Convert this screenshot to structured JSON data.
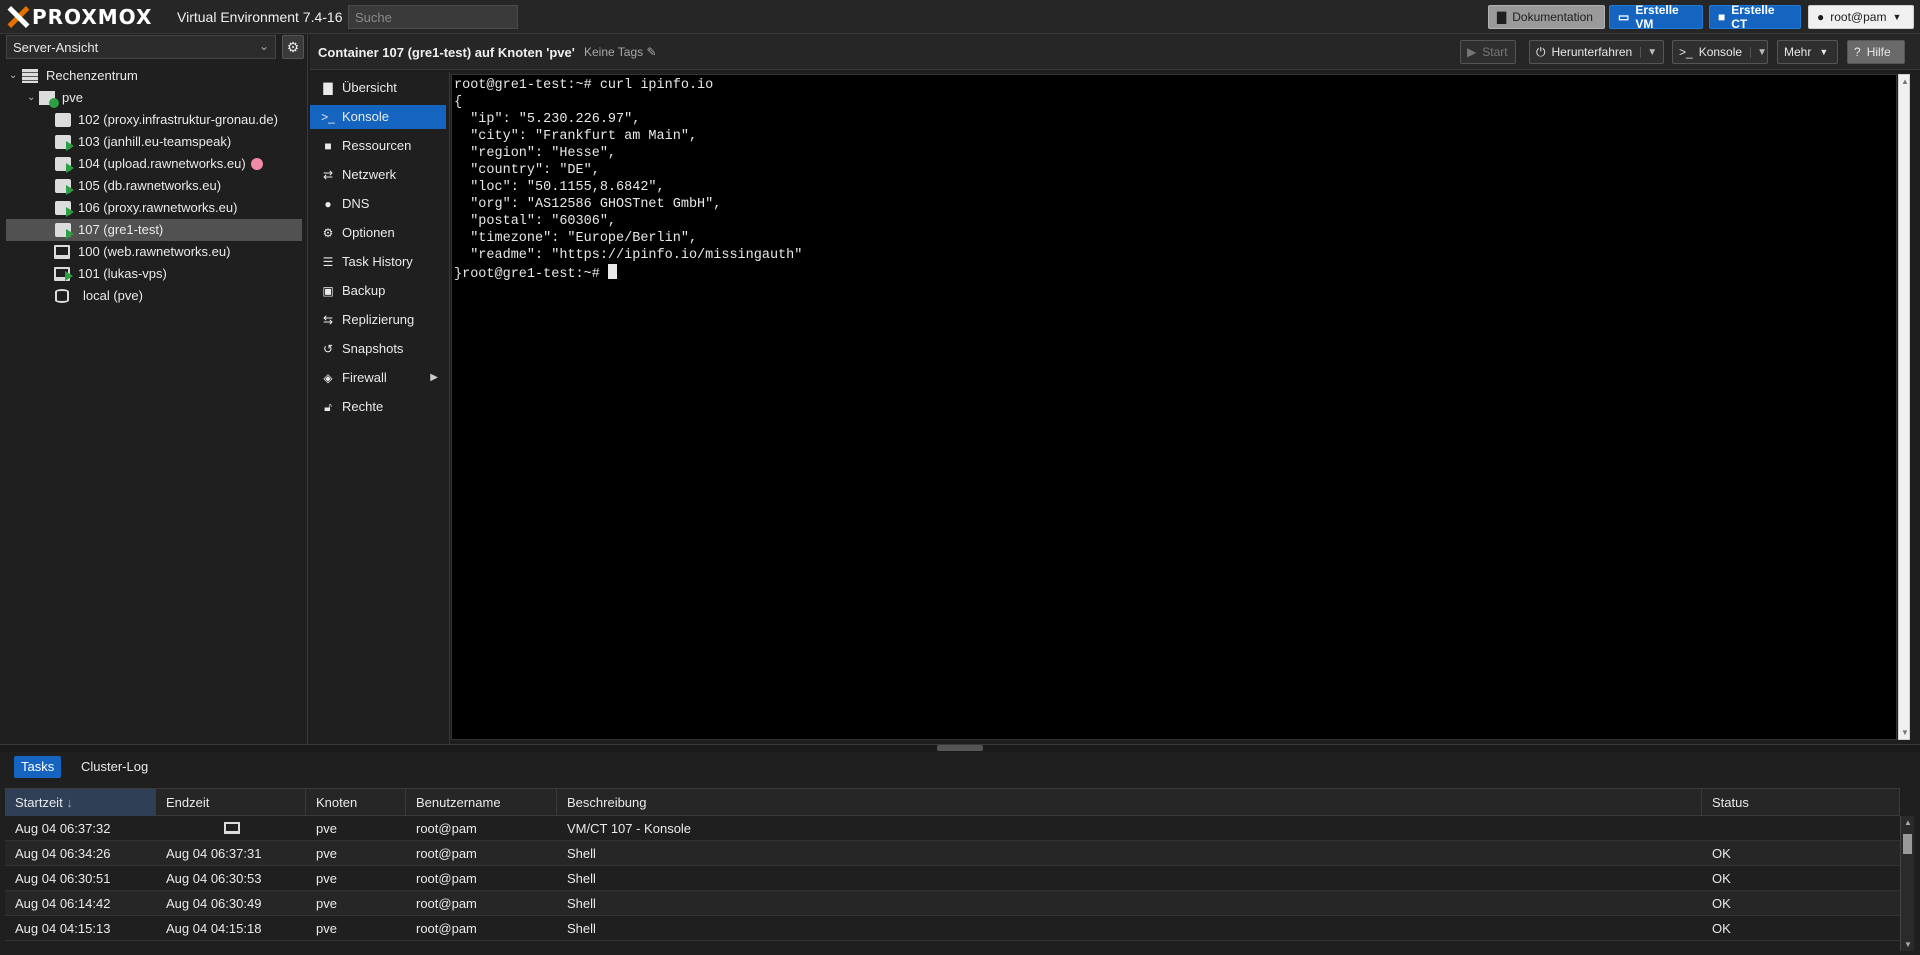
{
  "app": {
    "logo_text": "PROXMOX",
    "version_label": "Virtual Environment 7.4-16",
    "search_placeholder": "Suche"
  },
  "topbar": {
    "docs_label": "Dokumentation",
    "create_vm_label": "Erstelle VM",
    "create_ct_label": "Erstelle CT",
    "user_label": "root@pam"
  },
  "left": {
    "view_select": "Server-Ansicht",
    "tree": [
      {
        "label": "Rechenzentrum",
        "type": "datacenter"
      },
      {
        "label": "pve",
        "type": "node"
      },
      {
        "label": "102 (proxy.infrastruktur-gronau.de)",
        "type": "ct",
        "running": false
      },
      {
        "label": "103 (janhill.eu-teamspeak)",
        "type": "ct",
        "running": true
      },
      {
        "label": "104 (upload.rawnetworks.eu)",
        "type": "ct",
        "running": true,
        "tag_color": "#f08aa6"
      },
      {
        "label": "105 (db.rawnetworks.eu)",
        "type": "ct",
        "running": true
      },
      {
        "label": "106 (proxy.rawnetworks.eu)",
        "type": "ct",
        "running": true
      },
      {
        "label": "107 (gre1-test)",
        "type": "ct",
        "running": true,
        "selected": true
      },
      {
        "label": "100 (web.rawnetworks.eu)",
        "type": "vm",
        "running": false
      },
      {
        "label": "101 (lukas-vps)",
        "type": "vm",
        "running": true
      },
      {
        "label": "local (pve)",
        "type": "storage"
      }
    ]
  },
  "content": {
    "title": "Container 107 (gre1-test) auf Knoten 'pve'",
    "tags_label": "Keine Tags",
    "start_label": "Start",
    "shutdown_label": "Herunterfahren",
    "console_label": "Konsole",
    "more_label": "Mehr",
    "help_label": "Hilfe"
  },
  "subnav": [
    {
      "label": "Übersicht",
      "icon": "book-icon"
    },
    {
      "label": "Konsole",
      "icon": "terminal-icon",
      "active": true
    },
    {
      "label": "Ressourcen",
      "icon": "cube-icon"
    },
    {
      "label": "Netzwerk",
      "icon": "exchange-icon"
    },
    {
      "label": "DNS",
      "icon": "globe-icon"
    },
    {
      "label": "Optionen",
      "icon": "gear-icon"
    },
    {
      "label": "Task History",
      "icon": "list-icon"
    },
    {
      "label": "Backup",
      "icon": "floppy-icon"
    },
    {
      "label": "Replizierung",
      "icon": "retweet-icon"
    },
    {
      "label": "Snapshots",
      "icon": "history-icon"
    },
    {
      "label": "Firewall",
      "icon": "shield-icon",
      "has_submenu": true
    },
    {
      "label": "Rechte",
      "icon": "unlock-icon"
    }
  ],
  "terminal": {
    "lines": [
      "root@gre1-test:~# curl ipinfo.io",
      "{",
      "  \"ip\": \"5.230.226.97\",",
      "  \"city\": \"Frankfurt am Main\",",
      "  \"region\": \"Hesse\",",
      "  \"country\": \"DE\",",
      "  \"loc\": \"50.1155,8.6842\",",
      "  \"org\": \"AS12586 GHOSTnet GmbH\",",
      "  \"postal\": \"60306\",",
      "  \"timezone\": \"Europe/Berlin\",",
      "  \"readme\": \"https://ipinfo.io/missingauth\""
    ],
    "prompt_line": "}root@gre1-test:~# "
  },
  "bottom": {
    "tabs": [
      "Tasks",
      "Cluster-Log"
    ],
    "columns": [
      "Startzeit",
      "Endzeit",
      "Knoten",
      "Benutzername",
      "Beschreibung",
      "Status"
    ],
    "sort_indicator": "↓",
    "rows": [
      {
        "start": "Aug 04 06:37:32",
        "end": "",
        "end_icon": "monitor-icon",
        "node": "pve",
        "user": "root@pam",
        "desc": "VM/CT 107 - Konsole",
        "status": ""
      },
      {
        "start": "Aug 04 06:34:26",
        "end": "Aug 04 06:37:31",
        "node": "pve",
        "user": "root@pam",
        "desc": "Shell",
        "status": "OK"
      },
      {
        "start": "Aug 04 06:30:51",
        "end": "Aug 04 06:30:53",
        "node": "pve",
        "user": "root@pam",
        "desc": "Shell",
        "status": "OK"
      },
      {
        "start": "Aug 04 06:14:42",
        "end": "Aug 04 06:30:49",
        "node": "pve",
        "user": "root@pam",
        "desc": "Shell",
        "status": "OK"
      },
      {
        "start": "Aug 04 04:15:13",
        "end": "Aug 04 04:15:18",
        "node": "pve",
        "user": "root@pam",
        "desc": "Shell",
        "status": "OK"
      }
    ]
  },
  "colors": {
    "accent": "#1565c0",
    "brand_orange": "#e57000",
    "running_green": "#2ea043"
  }
}
